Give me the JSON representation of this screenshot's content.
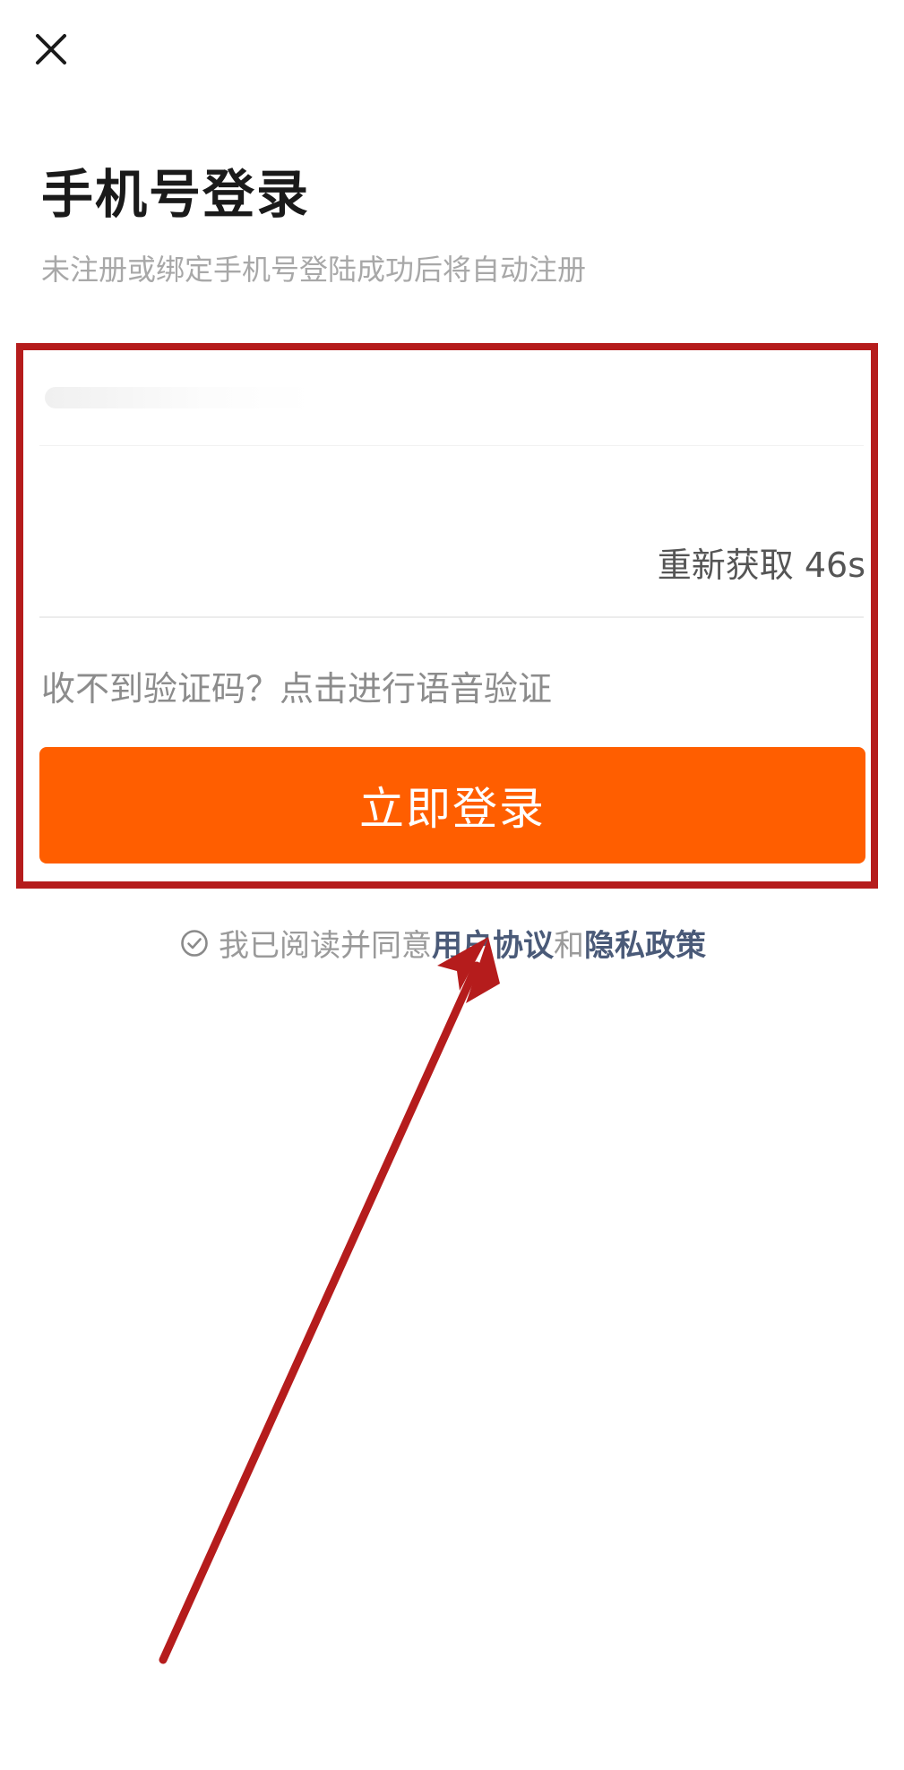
{
  "header": {
    "close_icon": "close-icon"
  },
  "login": {
    "title": "手机号登录",
    "subtitle": "未注册或绑定手机号登陆成功后将自动注册",
    "phone_value": "",
    "code_value": "",
    "resend_label": "重新获取 46s",
    "voice_link": "收不到验证码？点击进行语音验证",
    "submit_label": "立即登录"
  },
  "agreement": {
    "check_icon": "check-circle-icon",
    "prefix": "我已阅读并同意",
    "user_agreement": "用户协议",
    "and": "和",
    "privacy_policy": "隐私政策"
  },
  "colors": {
    "accent": "#ff5e00",
    "link": "#4a5a78",
    "annotation": "#b51c1c"
  }
}
